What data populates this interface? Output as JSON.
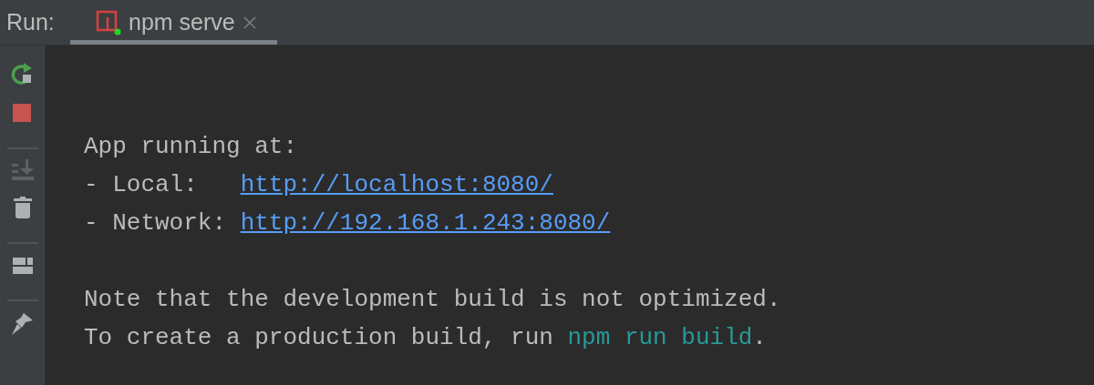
{
  "header": {
    "label": "Run:",
    "tabs": [
      {
        "label": "npm serve",
        "selected": true,
        "running": true
      }
    ]
  },
  "toolbar": {
    "groups": [
      [
        {
          "kind": "rerun",
          "disabled": false
        },
        {
          "kind": "stop",
          "disabled": false
        }
      ],
      [
        {
          "kind": "scroll-end",
          "disabled": true
        },
        {
          "kind": "trash",
          "disabled": false
        }
      ],
      [
        {
          "kind": "layout",
          "disabled": false
        }
      ],
      [
        {
          "kind": "pin",
          "disabled": false
        }
      ]
    ]
  },
  "console": {
    "blocks": [
      {
        "lines": [
          [
            {
              "kind": "text",
              "text": "App running at:"
            }
          ],
          [
            {
              "kind": "text",
              "text": "- Local:   "
            },
            {
              "kind": "link",
              "text": "http://localhost:8080/"
            }
          ],
          [
            {
              "kind": "text",
              "text": "- Network: "
            },
            {
              "kind": "link",
              "text": "http://192.168.1.243:8080/"
            }
          ]
        ]
      },
      {
        "lines": [
          [
            {
              "kind": "text",
              "text": "Note that the development build is not optimized."
            }
          ],
          [
            {
              "kind": "text",
              "text": "To create a production build, run "
            },
            {
              "kind": "command",
              "text": "npm run build"
            },
            {
              "kind": "text",
              "text": "."
            }
          ]
        ]
      }
    ]
  }
}
